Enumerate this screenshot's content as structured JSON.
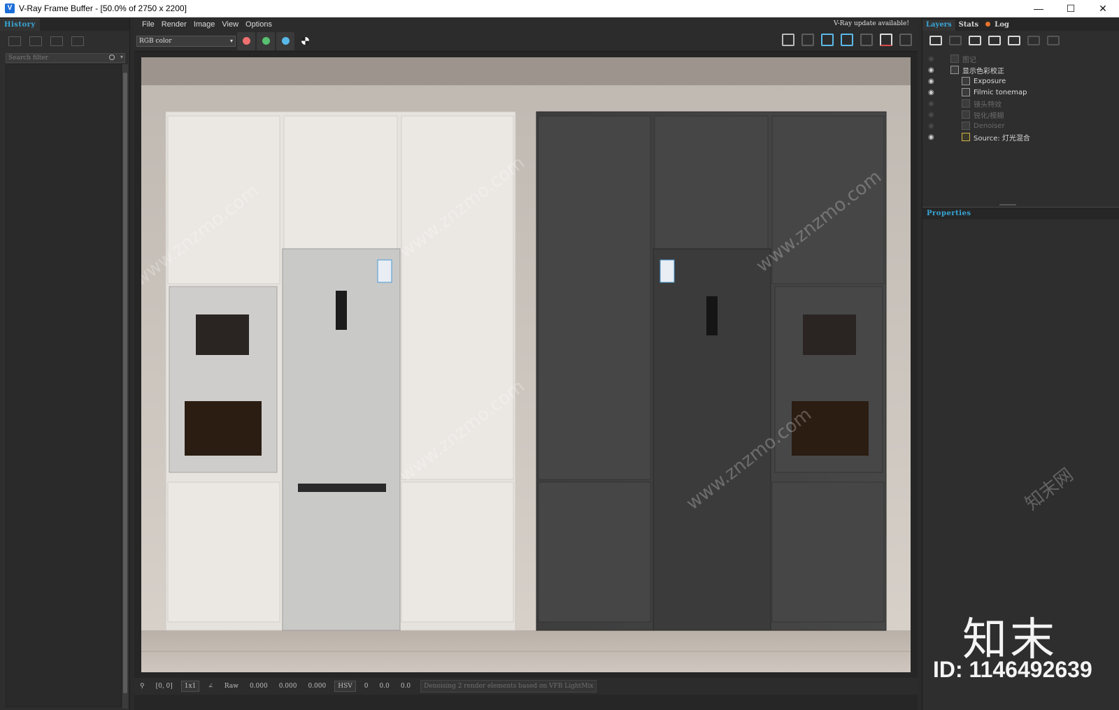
{
  "window": {
    "title": "V-Ray Frame Buffer - [50.0% of 2750 x 2200]",
    "controls": [
      "—",
      "☐",
      "✕"
    ]
  },
  "left_panel": {
    "tab": "History",
    "search_placeholder": "Search filter"
  },
  "menu": {
    "items": [
      "File",
      "Render",
      "Image",
      "View",
      "Options"
    ],
    "update_notice": "V-Ray update available!"
  },
  "toolbar": {
    "channel": "RGB color",
    "colors": {
      "red": "#f07070",
      "green": "#58c070",
      "blue": "#58b8e8"
    }
  },
  "status_bar": {
    "coords": "[0, 0]",
    "zoom": "1x1",
    "raw_label": "Raw",
    "rgb_values": [
      "0.000",
      "0.000",
      "0.000"
    ],
    "color_mode": "HSV",
    "hsv_values": [
      "0",
      "0.0",
      "0.0"
    ],
    "message": "Denoising 2 render elements based on VFB LightMix"
  },
  "right_panel": {
    "tabs": [
      "Layers",
      "Stats",
      "Log"
    ],
    "layers": [
      {
        "name": "图记",
        "visible": false,
        "enabled": false,
        "indent": 0
      },
      {
        "name": "显示色彩校正",
        "visible": true,
        "enabled": true,
        "indent": 0
      },
      {
        "name": "Exposure",
        "visible": true,
        "enabled": true,
        "indent": 1
      },
      {
        "name": "Filmic tonemap",
        "visible": true,
        "enabled": true,
        "indent": 1
      },
      {
        "name": "镜头特效",
        "visible": false,
        "enabled": false,
        "indent": 1
      },
      {
        "name": "锐化/模糊",
        "visible": false,
        "enabled": false,
        "indent": 1
      },
      {
        "name": "Denoiser",
        "visible": false,
        "enabled": false,
        "indent": 1
      },
      {
        "name": "Source: 灯光混合",
        "visible": true,
        "enabled": true,
        "indent": 1
      }
    ],
    "properties_label": "Properties"
  },
  "watermark": {
    "brand": "知末",
    "id": "ID: 1146492639",
    "site": "www.znzmo.com",
    "site_cn": "知末网"
  }
}
